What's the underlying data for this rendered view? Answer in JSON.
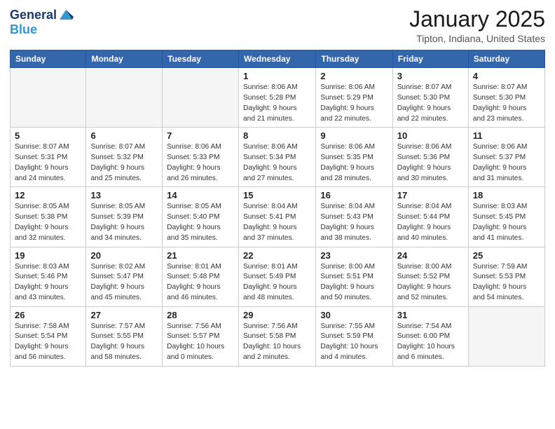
{
  "logo": {
    "general": "General",
    "blue": "Blue"
  },
  "title": "January 2025",
  "location": "Tipton, Indiana, United States",
  "weekdays": [
    "Sunday",
    "Monday",
    "Tuesday",
    "Wednesday",
    "Thursday",
    "Friday",
    "Saturday"
  ],
  "weeks": [
    [
      {
        "day": "",
        "info": ""
      },
      {
        "day": "",
        "info": ""
      },
      {
        "day": "",
        "info": ""
      },
      {
        "day": "1",
        "info": "Sunrise: 8:06 AM\nSunset: 5:28 PM\nDaylight: 9 hours\nand 21 minutes."
      },
      {
        "day": "2",
        "info": "Sunrise: 8:06 AM\nSunset: 5:29 PM\nDaylight: 9 hours\nand 22 minutes."
      },
      {
        "day": "3",
        "info": "Sunrise: 8:07 AM\nSunset: 5:30 PM\nDaylight: 9 hours\nand 22 minutes."
      },
      {
        "day": "4",
        "info": "Sunrise: 8:07 AM\nSunset: 5:30 PM\nDaylight: 9 hours\nand 23 minutes."
      }
    ],
    [
      {
        "day": "5",
        "info": "Sunrise: 8:07 AM\nSunset: 5:31 PM\nDaylight: 9 hours\nand 24 minutes."
      },
      {
        "day": "6",
        "info": "Sunrise: 8:07 AM\nSunset: 5:32 PM\nDaylight: 9 hours\nand 25 minutes."
      },
      {
        "day": "7",
        "info": "Sunrise: 8:06 AM\nSunset: 5:33 PM\nDaylight: 9 hours\nand 26 minutes."
      },
      {
        "day": "8",
        "info": "Sunrise: 8:06 AM\nSunset: 5:34 PM\nDaylight: 9 hours\nand 27 minutes."
      },
      {
        "day": "9",
        "info": "Sunrise: 8:06 AM\nSunset: 5:35 PM\nDaylight: 9 hours\nand 28 minutes."
      },
      {
        "day": "10",
        "info": "Sunrise: 8:06 AM\nSunset: 5:36 PM\nDaylight: 9 hours\nand 30 minutes."
      },
      {
        "day": "11",
        "info": "Sunrise: 8:06 AM\nSunset: 5:37 PM\nDaylight: 9 hours\nand 31 minutes."
      }
    ],
    [
      {
        "day": "12",
        "info": "Sunrise: 8:05 AM\nSunset: 5:38 PM\nDaylight: 9 hours\nand 32 minutes."
      },
      {
        "day": "13",
        "info": "Sunrise: 8:05 AM\nSunset: 5:39 PM\nDaylight: 9 hours\nand 34 minutes."
      },
      {
        "day": "14",
        "info": "Sunrise: 8:05 AM\nSunset: 5:40 PM\nDaylight: 9 hours\nand 35 minutes."
      },
      {
        "day": "15",
        "info": "Sunrise: 8:04 AM\nSunset: 5:41 PM\nDaylight: 9 hours\nand 37 minutes."
      },
      {
        "day": "16",
        "info": "Sunrise: 8:04 AM\nSunset: 5:43 PM\nDaylight: 9 hours\nand 38 minutes."
      },
      {
        "day": "17",
        "info": "Sunrise: 8:04 AM\nSunset: 5:44 PM\nDaylight: 9 hours\nand 40 minutes."
      },
      {
        "day": "18",
        "info": "Sunrise: 8:03 AM\nSunset: 5:45 PM\nDaylight: 9 hours\nand 41 minutes."
      }
    ],
    [
      {
        "day": "19",
        "info": "Sunrise: 8:03 AM\nSunset: 5:46 PM\nDaylight: 9 hours\nand 43 minutes."
      },
      {
        "day": "20",
        "info": "Sunrise: 8:02 AM\nSunset: 5:47 PM\nDaylight: 9 hours\nand 45 minutes."
      },
      {
        "day": "21",
        "info": "Sunrise: 8:01 AM\nSunset: 5:48 PM\nDaylight: 9 hours\nand 46 minutes."
      },
      {
        "day": "22",
        "info": "Sunrise: 8:01 AM\nSunset: 5:49 PM\nDaylight: 9 hours\nand 48 minutes."
      },
      {
        "day": "23",
        "info": "Sunrise: 8:00 AM\nSunset: 5:51 PM\nDaylight: 9 hours\nand 50 minutes."
      },
      {
        "day": "24",
        "info": "Sunrise: 8:00 AM\nSunset: 5:52 PM\nDaylight: 9 hours\nand 52 minutes."
      },
      {
        "day": "25",
        "info": "Sunrise: 7:59 AM\nSunset: 5:53 PM\nDaylight: 9 hours\nand 54 minutes."
      }
    ],
    [
      {
        "day": "26",
        "info": "Sunrise: 7:58 AM\nSunset: 5:54 PM\nDaylight: 9 hours\nand 56 minutes."
      },
      {
        "day": "27",
        "info": "Sunrise: 7:57 AM\nSunset: 5:55 PM\nDaylight: 9 hours\nand 58 minutes."
      },
      {
        "day": "28",
        "info": "Sunrise: 7:56 AM\nSunset: 5:57 PM\nDaylight: 10 hours\nand 0 minutes."
      },
      {
        "day": "29",
        "info": "Sunrise: 7:56 AM\nSunset: 5:58 PM\nDaylight: 10 hours\nand 2 minutes."
      },
      {
        "day": "30",
        "info": "Sunrise: 7:55 AM\nSunset: 5:59 PM\nDaylight: 10 hours\nand 4 minutes."
      },
      {
        "day": "31",
        "info": "Sunrise: 7:54 AM\nSunset: 6:00 PM\nDaylight: 10 hours\nand 6 minutes."
      },
      {
        "day": "",
        "info": ""
      }
    ]
  ]
}
